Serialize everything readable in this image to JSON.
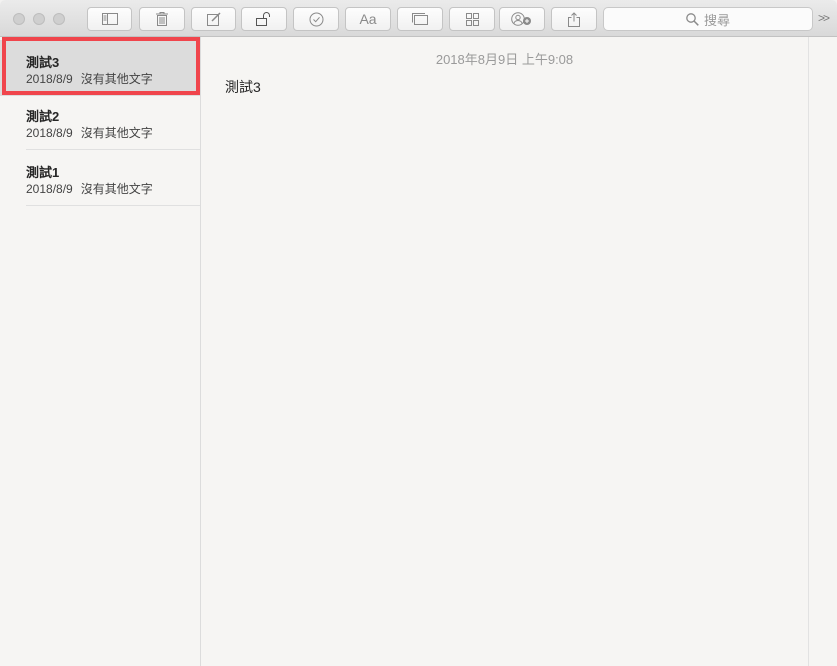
{
  "toolbar": {
    "buttons": [
      {
        "name": "toggle-sidebar-button",
        "icon": "sidebar-icon"
      },
      {
        "name": "delete-button",
        "icon": "trash-icon"
      },
      {
        "name": "compose-button",
        "icon": "compose-icon"
      },
      {
        "name": "lock-button",
        "icon": "lock-icon"
      },
      {
        "name": "checklist-button",
        "icon": "checkmark-circle-icon"
      },
      {
        "name": "format-button",
        "icon": "text-format-icon"
      },
      {
        "name": "table-button",
        "icon": "media-icon"
      },
      {
        "name": "attachments-button",
        "icon": "grid-icon"
      },
      {
        "name": "add-people-button",
        "icon": "add-people-icon"
      },
      {
        "name": "share-button",
        "icon": "share-icon"
      }
    ],
    "format_label": "Aa",
    "search_placeholder": "搜尋",
    "overflow_label": ">>"
  },
  "sidebar": {
    "notes": [
      {
        "title": "測試3",
        "date": "2018/8/9",
        "preview": "沒有其他文字",
        "selected": true
      },
      {
        "title": "測試2",
        "date": "2018/8/9",
        "preview": "沒有其他文字",
        "selected": false
      },
      {
        "title": "測試1",
        "date": "2018/8/9",
        "preview": "沒有其他文字",
        "selected": false
      }
    ]
  },
  "editor": {
    "timestamp": "2018年8月9日 上午9:08",
    "content": "測試3"
  },
  "colors": {
    "highlight": "#f0454c",
    "selected_row": "#dcdcdc"
  }
}
